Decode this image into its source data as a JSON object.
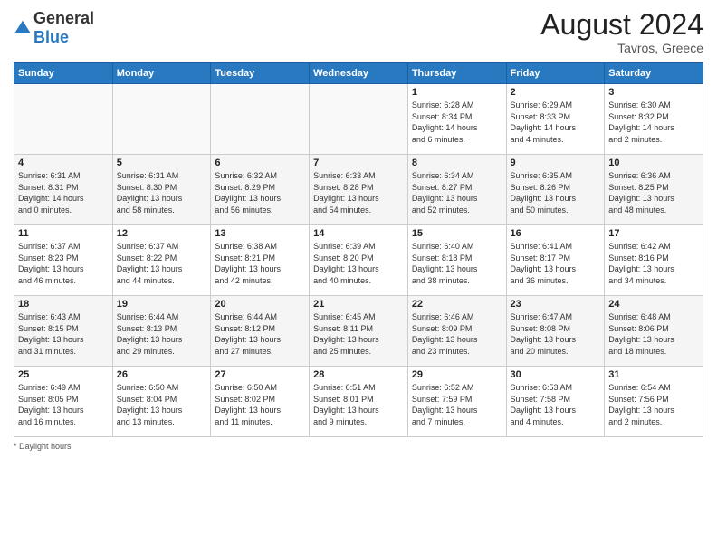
{
  "logo": {
    "general": "General",
    "blue": "Blue"
  },
  "header": {
    "month_year": "August 2024",
    "location": "Tavros, Greece"
  },
  "days_of_week": [
    "Sunday",
    "Monday",
    "Tuesday",
    "Wednesday",
    "Thursday",
    "Friday",
    "Saturday"
  ],
  "footer": {
    "daylight_label": "Daylight hours"
  },
  "weeks": [
    [
      {
        "day": "",
        "info": ""
      },
      {
        "day": "",
        "info": ""
      },
      {
        "day": "",
        "info": ""
      },
      {
        "day": "",
        "info": ""
      },
      {
        "day": "1",
        "info": "Sunrise: 6:28 AM\nSunset: 8:34 PM\nDaylight: 14 hours\nand 6 minutes."
      },
      {
        "day": "2",
        "info": "Sunrise: 6:29 AM\nSunset: 8:33 PM\nDaylight: 14 hours\nand 4 minutes."
      },
      {
        "day": "3",
        "info": "Sunrise: 6:30 AM\nSunset: 8:32 PM\nDaylight: 14 hours\nand 2 minutes."
      }
    ],
    [
      {
        "day": "4",
        "info": "Sunrise: 6:31 AM\nSunset: 8:31 PM\nDaylight: 14 hours\nand 0 minutes."
      },
      {
        "day": "5",
        "info": "Sunrise: 6:31 AM\nSunset: 8:30 PM\nDaylight: 13 hours\nand 58 minutes."
      },
      {
        "day": "6",
        "info": "Sunrise: 6:32 AM\nSunset: 8:29 PM\nDaylight: 13 hours\nand 56 minutes."
      },
      {
        "day": "7",
        "info": "Sunrise: 6:33 AM\nSunset: 8:28 PM\nDaylight: 13 hours\nand 54 minutes."
      },
      {
        "day": "8",
        "info": "Sunrise: 6:34 AM\nSunset: 8:27 PM\nDaylight: 13 hours\nand 52 minutes."
      },
      {
        "day": "9",
        "info": "Sunrise: 6:35 AM\nSunset: 8:26 PM\nDaylight: 13 hours\nand 50 minutes."
      },
      {
        "day": "10",
        "info": "Sunrise: 6:36 AM\nSunset: 8:25 PM\nDaylight: 13 hours\nand 48 minutes."
      }
    ],
    [
      {
        "day": "11",
        "info": "Sunrise: 6:37 AM\nSunset: 8:23 PM\nDaylight: 13 hours\nand 46 minutes."
      },
      {
        "day": "12",
        "info": "Sunrise: 6:37 AM\nSunset: 8:22 PM\nDaylight: 13 hours\nand 44 minutes."
      },
      {
        "day": "13",
        "info": "Sunrise: 6:38 AM\nSunset: 8:21 PM\nDaylight: 13 hours\nand 42 minutes."
      },
      {
        "day": "14",
        "info": "Sunrise: 6:39 AM\nSunset: 8:20 PM\nDaylight: 13 hours\nand 40 minutes."
      },
      {
        "day": "15",
        "info": "Sunrise: 6:40 AM\nSunset: 8:18 PM\nDaylight: 13 hours\nand 38 minutes."
      },
      {
        "day": "16",
        "info": "Sunrise: 6:41 AM\nSunset: 8:17 PM\nDaylight: 13 hours\nand 36 minutes."
      },
      {
        "day": "17",
        "info": "Sunrise: 6:42 AM\nSunset: 8:16 PM\nDaylight: 13 hours\nand 34 minutes."
      }
    ],
    [
      {
        "day": "18",
        "info": "Sunrise: 6:43 AM\nSunset: 8:15 PM\nDaylight: 13 hours\nand 31 minutes."
      },
      {
        "day": "19",
        "info": "Sunrise: 6:44 AM\nSunset: 8:13 PM\nDaylight: 13 hours\nand 29 minutes."
      },
      {
        "day": "20",
        "info": "Sunrise: 6:44 AM\nSunset: 8:12 PM\nDaylight: 13 hours\nand 27 minutes."
      },
      {
        "day": "21",
        "info": "Sunrise: 6:45 AM\nSunset: 8:11 PM\nDaylight: 13 hours\nand 25 minutes."
      },
      {
        "day": "22",
        "info": "Sunrise: 6:46 AM\nSunset: 8:09 PM\nDaylight: 13 hours\nand 23 minutes."
      },
      {
        "day": "23",
        "info": "Sunrise: 6:47 AM\nSunset: 8:08 PM\nDaylight: 13 hours\nand 20 minutes."
      },
      {
        "day": "24",
        "info": "Sunrise: 6:48 AM\nSunset: 8:06 PM\nDaylight: 13 hours\nand 18 minutes."
      }
    ],
    [
      {
        "day": "25",
        "info": "Sunrise: 6:49 AM\nSunset: 8:05 PM\nDaylight: 13 hours\nand 16 minutes."
      },
      {
        "day": "26",
        "info": "Sunrise: 6:50 AM\nSunset: 8:04 PM\nDaylight: 13 hours\nand 13 minutes."
      },
      {
        "day": "27",
        "info": "Sunrise: 6:50 AM\nSunset: 8:02 PM\nDaylight: 13 hours\nand 11 minutes."
      },
      {
        "day": "28",
        "info": "Sunrise: 6:51 AM\nSunset: 8:01 PM\nDaylight: 13 hours\nand 9 minutes."
      },
      {
        "day": "29",
        "info": "Sunrise: 6:52 AM\nSunset: 7:59 PM\nDaylight: 13 hours\nand 7 minutes."
      },
      {
        "day": "30",
        "info": "Sunrise: 6:53 AM\nSunset: 7:58 PM\nDaylight: 13 hours\nand 4 minutes."
      },
      {
        "day": "31",
        "info": "Sunrise: 6:54 AM\nSunset: 7:56 PM\nDaylight: 13 hours\nand 2 minutes."
      }
    ]
  ]
}
